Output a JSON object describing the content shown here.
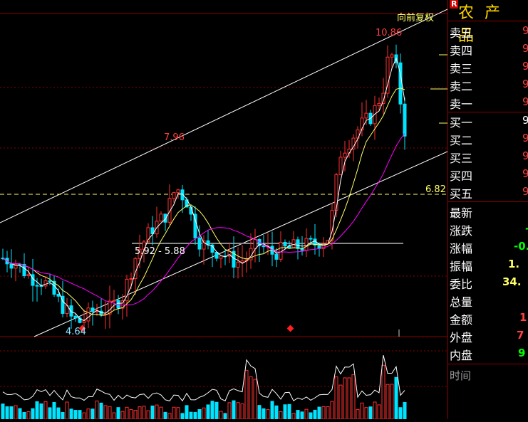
{
  "header": {
    "adjust_mode": "向前复权",
    "stock_name": "农 产 品",
    "r_badge": "R"
  },
  "price_labels": {
    "high": "10.86",
    "mid_high": "7.96",
    "low": "4.64",
    "right_level": "6.82",
    "gap_range": "5.92 - 5.88"
  },
  "order_book": {
    "asks": [
      {
        "label": "卖五",
        "value": "9"
      },
      {
        "label": "卖四",
        "value": "9"
      },
      {
        "label": "卖三",
        "value": "9"
      },
      {
        "label": "卖二",
        "value": "9"
      },
      {
        "label": "卖一",
        "value": "9"
      }
    ],
    "bids": [
      {
        "label": "买一",
        "value": "9"
      },
      {
        "label": "买二",
        "value": "9"
      },
      {
        "label": "买三",
        "value": "9"
      },
      {
        "label": "买四",
        "value": "9"
      },
      {
        "label": "买五",
        "value": "9"
      }
    ]
  },
  "stats": [
    {
      "label": "最新",
      "value": ""
    },
    {
      "label": "涨跌",
      "value": "-"
    },
    {
      "label": "涨幅",
      "value": "-0."
    },
    {
      "label": "振幅",
      "value": "1."
    },
    {
      "label": "委比",
      "value": "34."
    },
    {
      "label": "总量",
      "value": ""
    },
    {
      "label": "金额",
      "value": "1"
    },
    {
      "label": "外盘",
      "value": "7"
    },
    {
      "label": "内盘",
      "value": "9"
    }
  ],
  "time_label": "时间",
  "colors": {
    "up": "#ff3030",
    "down": "#00e5ff",
    "ma_short": "#ffffff",
    "ma_mid": "#ffff66",
    "ma_long": "#ff00ff",
    "level_line": "#ffff66",
    "grid": "#8b0000",
    "green_text": "#00ff00"
  }
}
